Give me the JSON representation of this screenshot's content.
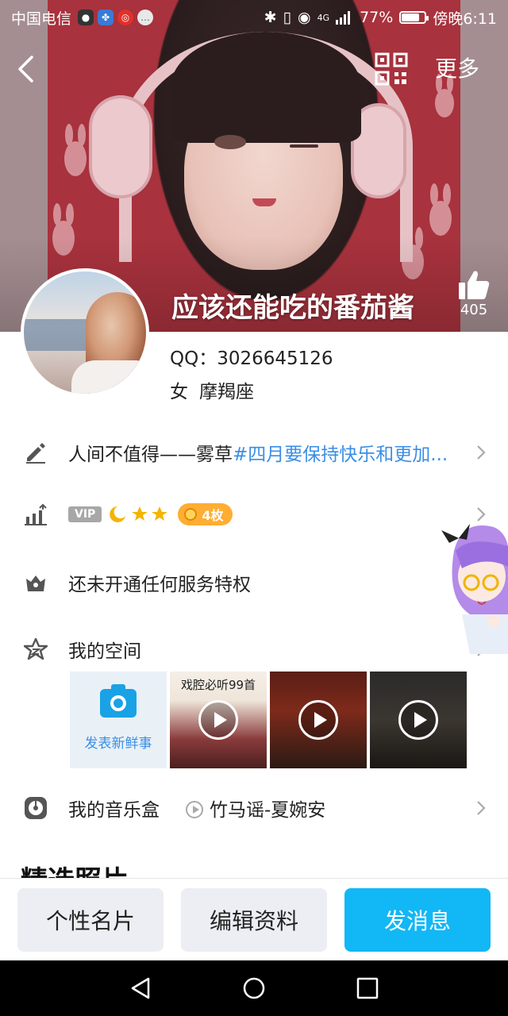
{
  "status_bar": {
    "carrier": "中国电信",
    "battery": "77%",
    "battery_level": 0.77,
    "time": "傍晚6:11",
    "network": "4G"
  },
  "nav": {
    "more_label": "更多"
  },
  "profile": {
    "nickname": "应该还能吃的番茄酱",
    "likes": "405",
    "qq_line": "QQ：3026645126",
    "gender": "女",
    "zodiac": "摩羯座"
  },
  "signature": {
    "text": "人间不值得——雾草",
    "tag": "#四月要保持快乐和更加..."
  },
  "level": {
    "vip_label": "VIP",
    "medal_label": "4枚"
  },
  "privilege": {
    "text": "还未开通任何服务特权"
  },
  "zone": {
    "title": "我的空间",
    "post_label": "发表新鲜事",
    "tiles": [
      {
        "caption": "戏腔必听99首"
      },
      {
        "caption": ""
      },
      {
        "caption": ""
      }
    ]
  },
  "music": {
    "title": "我的音乐盒",
    "track": "竹马谣-夏婉安"
  },
  "photos": {
    "title": "精选照片"
  },
  "actions": {
    "card_label": "个性名片",
    "edit_label": "编辑资料",
    "message_label": "发消息"
  },
  "colors": {
    "accent_blue": "#12b7f5",
    "link_blue": "#3a8ee6",
    "medal_orange": "#ffad33"
  }
}
